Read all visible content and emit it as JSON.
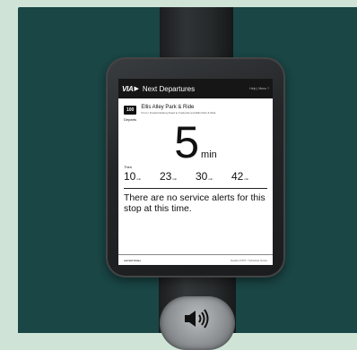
{
  "header": {
    "logo": "VIA",
    "title": "Next Departures",
    "help": "Help | Menu ?"
  },
  "stop": {
    "route_number": "100",
    "name": "Ellis Alley Park & Ride",
    "description": "From / Fredericksburg Road to Frederick and Ellis Park & Ride"
  },
  "departures": {
    "label": "Departs",
    "next_value": "5",
    "next_unit": "min",
    "then_label": "Then",
    "then": [
      {
        "value": "10",
        "unit": "min"
      },
      {
        "value": "23",
        "unit": "min"
      },
      {
        "value": "30",
        "unit": "min"
      },
      {
        "value": "42",
        "unit": "min"
      }
    ]
  },
  "alert": {
    "text": "There are no service alerts for this stop at this time."
  },
  "footer": {
    "left": "current times",
    "right": "Nearby RTPI / Schedule Notes"
  },
  "colors": {
    "backdrop": "#1a4646",
    "page": "#cfe4d6",
    "header": "#161616"
  },
  "icons": {
    "speaker": "speaker-icon"
  }
}
